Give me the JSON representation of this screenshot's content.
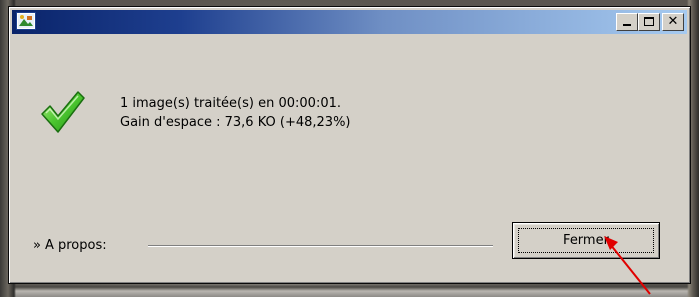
{
  "window": {
    "title": "",
    "controls": {
      "minimize_icon": "minimize-icon",
      "maximize_icon": "maximize-icon",
      "close_icon": "close-icon"
    },
    "accent": "#0a246a"
  },
  "message": {
    "icon": "checkmark-icon",
    "line1": "1 image(s) traitée(s) en 00:00:01.",
    "line2": "Gain d'espace : 73,6 KO (+48,23%)"
  },
  "footer": {
    "about_prefix": "»",
    "about_label": "A propos:",
    "close_button_label": "Fermer"
  },
  "annotation": {
    "arrow_color": "#e00000"
  }
}
